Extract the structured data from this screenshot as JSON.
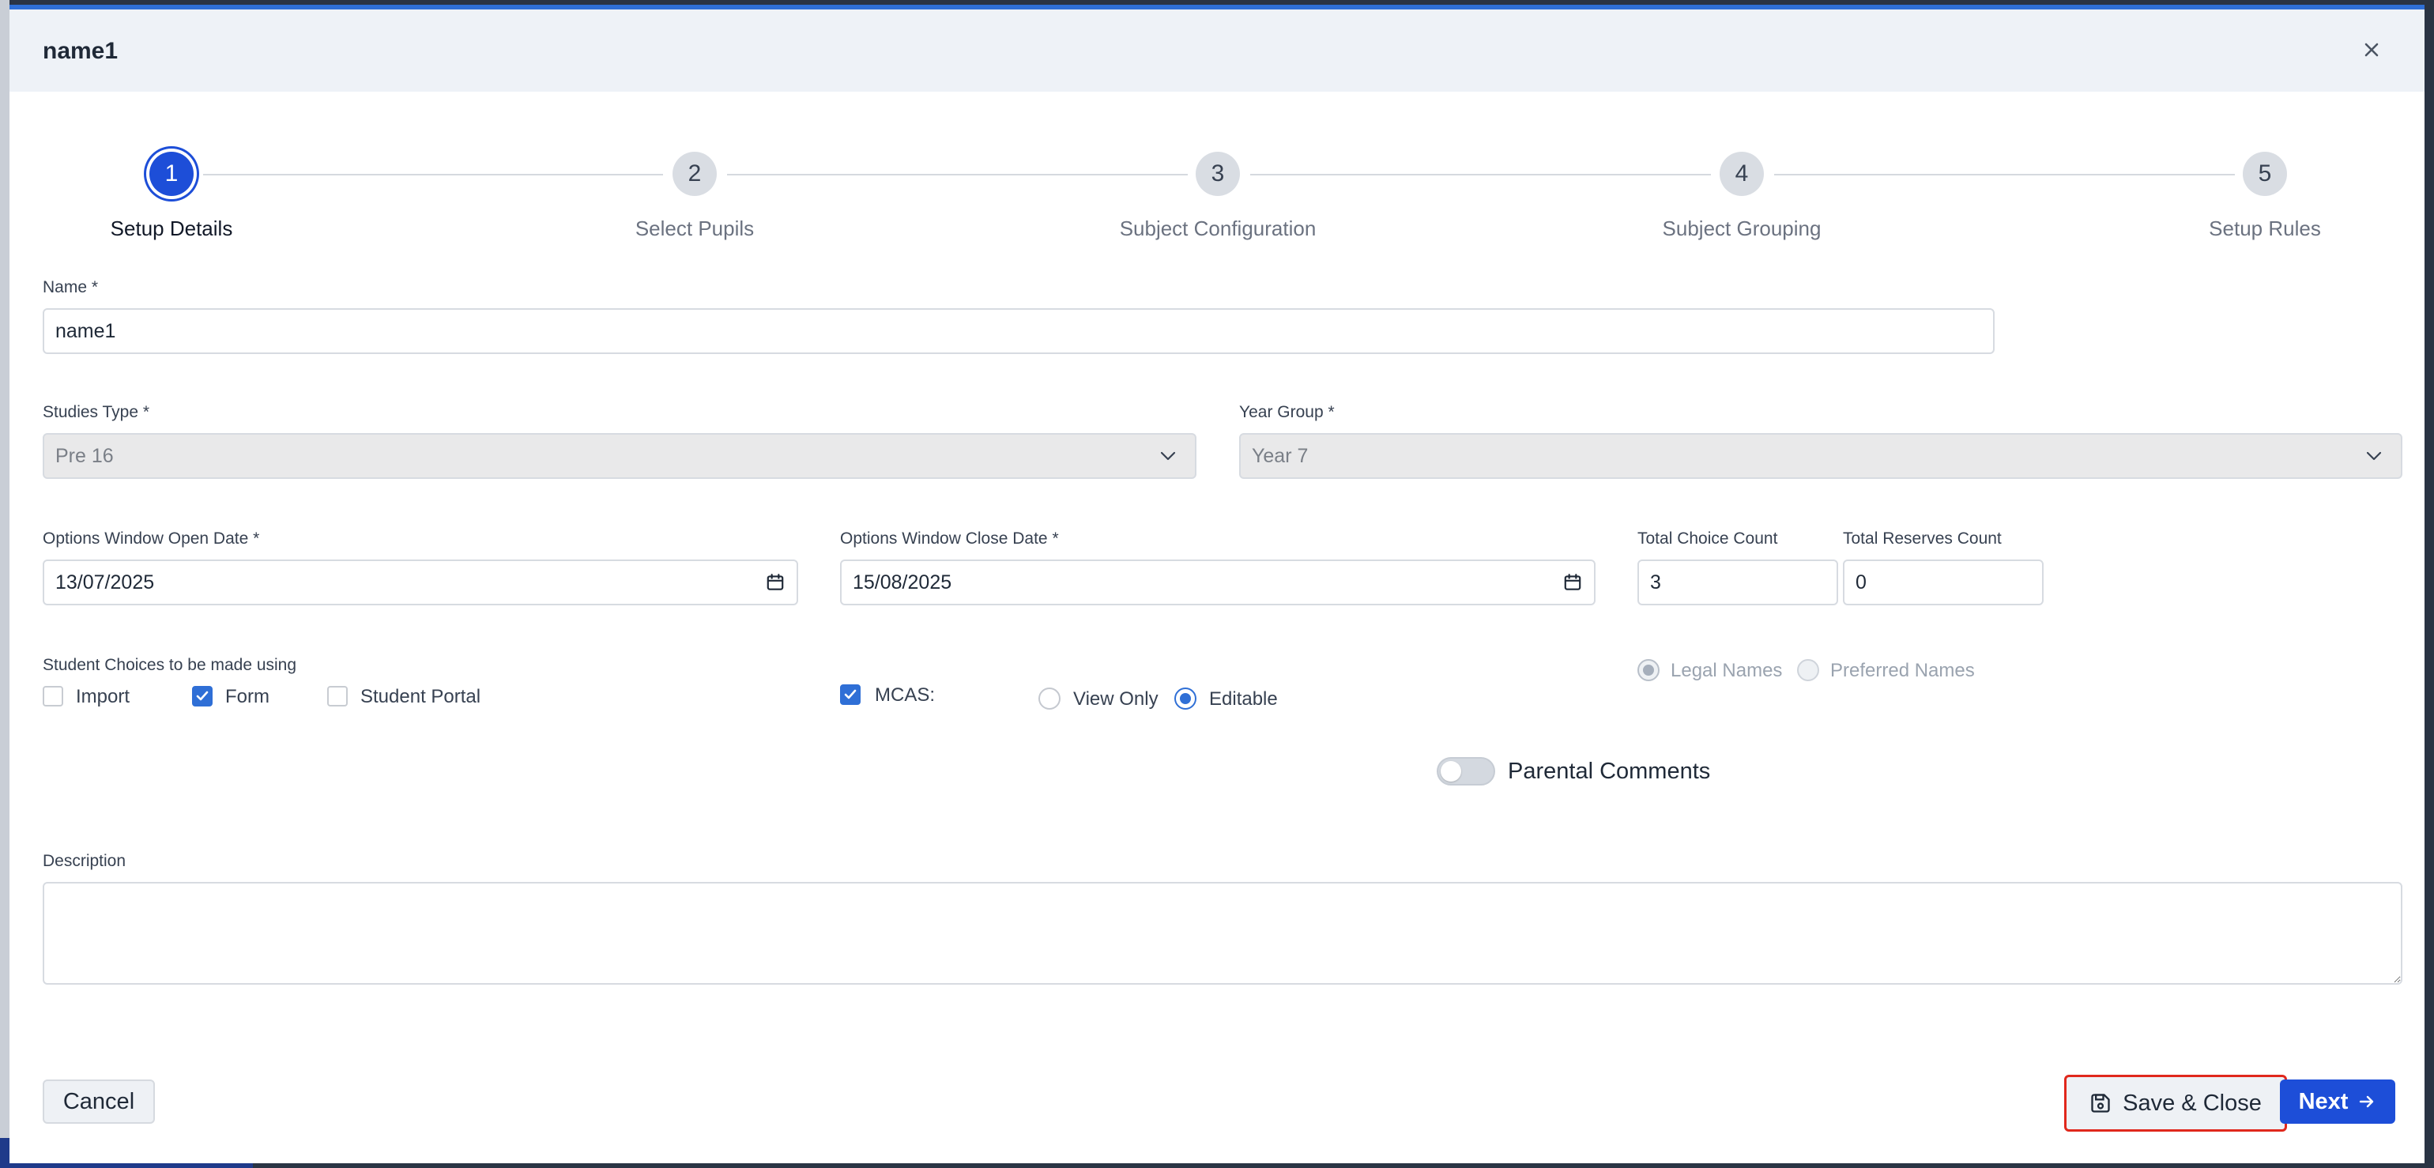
{
  "modal": {
    "title": "name1"
  },
  "stepper": {
    "steps": [
      {
        "number": "1",
        "label": "Setup Details",
        "active": true
      },
      {
        "number": "2",
        "label": "Select Pupils"
      },
      {
        "number": "3",
        "label": "Subject Configuration"
      },
      {
        "number": "4",
        "label": "Subject Grouping"
      },
      {
        "number": "5",
        "label": "Setup Rules"
      }
    ]
  },
  "form": {
    "name": {
      "label": "Name *",
      "value": "name1"
    },
    "studies_type": {
      "label": "Studies Type *",
      "value": "Pre 16"
    },
    "year_group": {
      "label": "Year Group *",
      "value": "Year 7"
    },
    "open_date": {
      "label": "Options Window Open Date *",
      "value": "13/07/2025"
    },
    "close_date": {
      "label": "Options Window Close Date *",
      "value": "15/08/2025"
    },
    "total_choice": {
      "label": "Total Choice Count",
      "value": "3"
    },
    "total_reserves": {
      "label": "Total Reserves Count",
      "value": "0"
    },
    "student_choices": {
      "label": "Student Choices to be made using",
      "options": [
        {
          "label": "Import",
          "checked": false
        },
        {
          "label": "Form",
          "checked": true
        },
        {
          "label": "Student Portal",
          "checked": false
        }
      ]
    },
    "mcas": {
      "label": "MCAS:",
      "checked": true,
      "view_only": "View Only",
      "editable": "Editable",
      "selected": "Editable"
    },
    "names": {
      "legal": "Legal Names",
      "preferred": "Preferred Names",
      "selected": "Legal Names"
    },
    "parental_comments": {
      "label": "Parental Comments",
      "on": false
    },
    "description": {
      "label": "Description",
      "value": ""
    }
  },
  "footer": {
    "cancel": "Cancel",
    "save_close": "Save & Close",
    "next": "Next"
  },
  "colors": {
    "primary": "#1d4ed8",
    "checkbox": "#2f6fd6",
    "highlight": "#e0281c"
  }
}
